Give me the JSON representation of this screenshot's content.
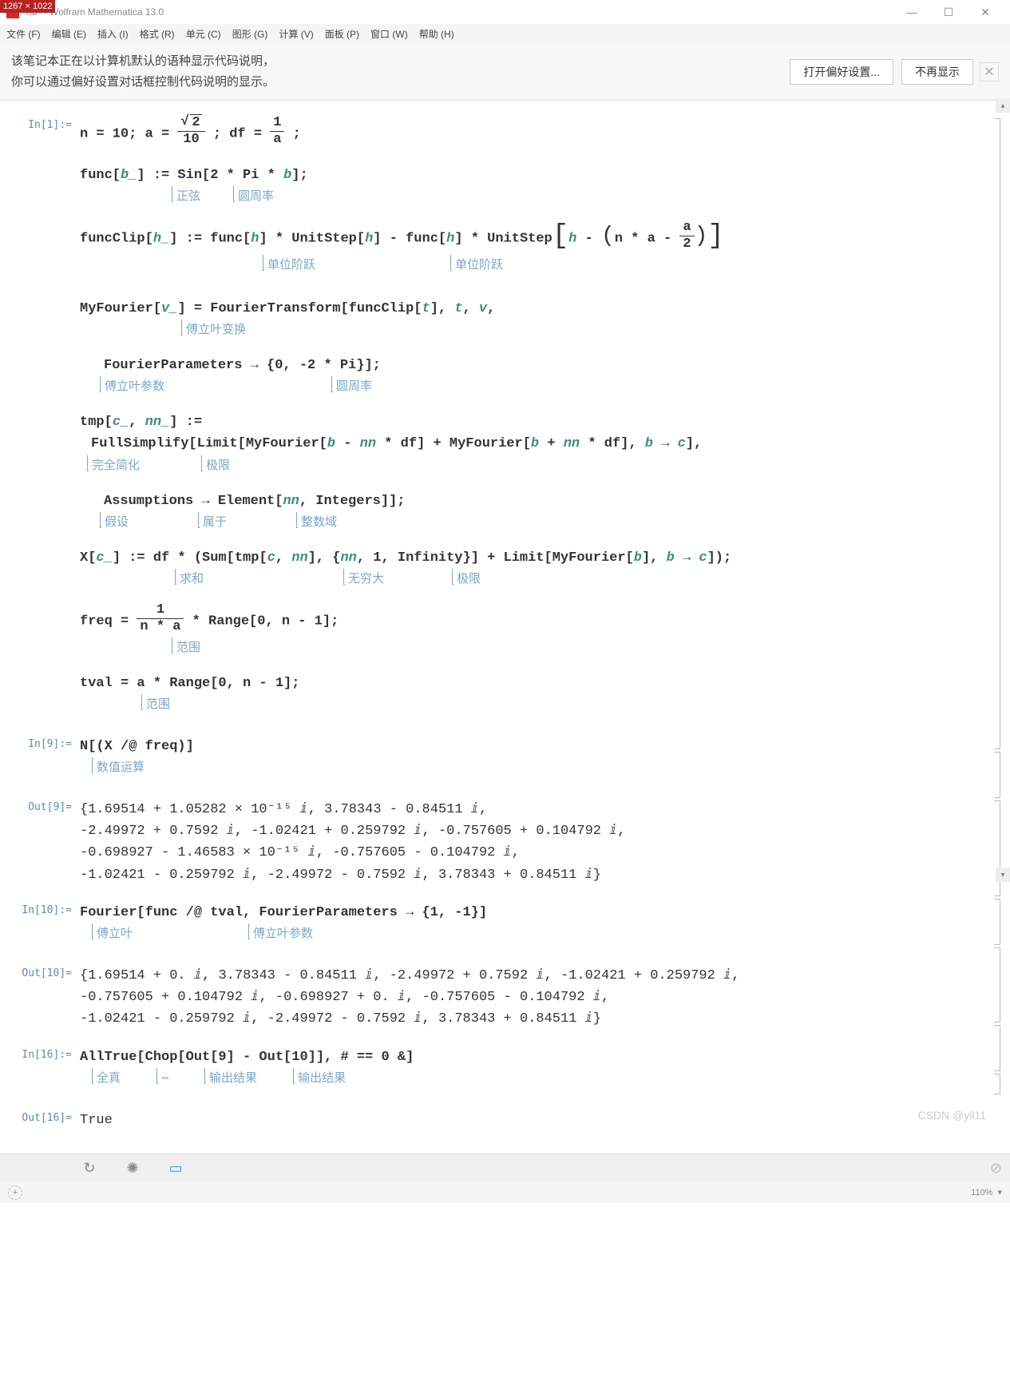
{
  "titlebar": {
    "dim_badge": "1267 × 1022",
    "filename": ".nb *",
    "app": " - Wolfram Mathematica 13.0"
  },
  "menubar": {
    "file": "文件 (F)",
    "edit": "编辑 (E)",
    "insert": "插入 (I)",
    "format": "格式 (R)",
    "cell": "单元 (C)",
    "graphics": "图形 (G)",
    "evaluation": "计算 (V)",
    "palettes": "面板 (P)",
    "window": "窗口 (W)",
    "help": "帮助 (H)"
  },
  "banner": {
    "line1": "该笔记本正在以计算机默认的语种显示代码说明，",
    "line2": "你可以通过偏好设置对话框控制代码说明的显示。",
    "btn_open": "打开偏好设置...",
    "btn_hide": "不再显示"
  },
  "cells": {
    "in1_label": "In[1]:=",
    "in1_line1_a": "n = 10; a = ",
    "in1_frac1_num": "2",
    "in1_frac1_den": "10",
    "in1_line1_b": "; df = ",
    "in1_frac2_num": "1",
    "in1_frac2_den": "a",
    "in1_line1_c": ";",
    "in1_line2": "func[b_] := Sin[2 * Pi * b];",
    "hint_sin": "正弦",
    "hint_pi": "圆周率",
    "in1_line3_a": "funcClip[h_] := func[h] * UnitStep[h] - func[h] * UnitStep",
    "in1_line3_b": "h - ",
    "in1_line3_c": "n * a - ",
    "in1_frac3_num": "a",
    "in1_frac3_den": "2",
    "hint_unitstep": "单位阶跃",
    "in1_line4_a": "MyFourier[v_] = FourierTransform[funcClip[t], t, v,",
    "hint_ft": "傅立叶变换",
    "in1_line5": "FourierParameters → {0, -2 * Pi}];",
    "hint_fp": "傅立叶参数",
    "in1_line6": "tmp[c_, nn_] :=",
    "in1_line7": "FullSimplify[Limit[MyFourier[b - nn * df] + MyFourier[b + nn * df], b → c],",
    "hint_fullsimp": "完全简化",
    "hint_limit": "极限",
    "in1_line8": "Assumptions → Element[nn, Integers]];",
    "hint_assume": "假设",
    "hint_element": "属于",
    "hint_integers": "整数域",
    "in1_line9": "X[c_] := df * (Sum[tmp[c, nn], {nn, 1, Infinity}] + Limit[MyFourier[b], b → c]);",
    "hint_sum": "求和",
    "hint_inf": "无穷大",
    "in1_line10_a": "freq = ",
    "in1_frac4_num": "1",
    "in1_frac4_den": "n * a",
    "in1_line10_b": " * Range[0, n - 1];",
    "hint_range": "范围",
    "in1_line11": "tval = a * Range[0, n - 1];",
    "in9_label": "In[9]:=",
    "in9": "N[(X /@ freq)]",
    "hint_n": "数值运算",
    "out9_label": "Out[9]=",
    "out9_l1": "{1.69514 + 1.05282 × 10⁻¹⁵ ⅈ, 3.78343 - 0.84511 ⅈ,",
    "out9_l2": " -2.49972 + 0.7592 ⅈ, -1.02421 + 0.259792 ⅈ, -0.757605 + 0.104792 ⅈ,",
    "out9_l3": " -0.698927 - 1.46583 × 10⁻¹⁵ ⅈ, -0.757605 - 0.104792 ⅈ,",
    "out9_l4": " -1.02421 - 0.259792 ⅈ, -2.49972 - 0.7592 ⅈ, 3.78343 + 0.84511 ⅈ}",
    "in10_label": "In[10]:=",
    "in10": "Fourier[func /@ tval, FourierParameters → {1, -1}]",
    "hint_fourier": "傅立叶",
    "out10_label": "Out[10]=",
    "out10_l1": "{1.69514 + 0. ⅈ, 3.78343 - 0.84511 ⅈ, -2.49972 + 0.7592 ⅈ, -1.02421 + 0.259792 ⅈ,",
    "out10_l2": " -0.757605 + 0.104792 ⅈ, -0.698927 + 0. ⅈ, -0.757605 - 0.104792 ⅈ,",
    "out10_l3": " -1.02421 - 0.259792 ⅈ, -2.49972 - 0.7592 ⅈ, 3.78343 + 0.84511 ⅈ}",
    "in16_label": "In[16]:=",
    "in16": "AllTrue[Chop[Out[9] - Out[10]], # == 0 &]",
    "hint_alltrue": "全真",
    "hint_dots": "⋯",
    "hint_out": "输出结果",
    "out16_label": "Out[16]=",
    "out16": "True"
  },
  "bottom": {
    "zoom": "110%",
    "watermark": "CSDN @yll11"
  }
}
